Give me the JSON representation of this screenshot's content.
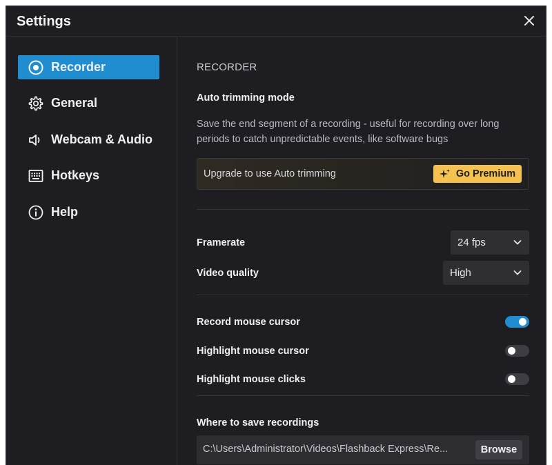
{
  "window": {
    "title": "Settings"
  },
  "sidebar": {
    "items": [
      {
        "label": "Recorder",
        "icon": "record-icon",
        "active": true
      },
      {
        "label": "General",
        "icon": "gear-icon",
        "active": false
      },
      {
        "label": "Webcam & Audio",
        "icon": "speaker-icon",
        "active": false
      },
      {
        "label": "Hotkeys",
        "icon": "keyboard-icon",
        "active": false
      },
      {
        "label": "Help",
        "icon": "info-icon",
        "active": false
      }
    ]
  },
  "recorder": {
    "section_title": "RECORDER",
    "auto_trim": {
      "heading": "Auto trimming mode",
      "description": "Save the end segment of a recording - useful for recording over long periods to catch unpredictable events, like software bugs",
      "upgrade_text": "Upgrade to use Auto trimming",
      "premium_label": "Go Premium"
    },
    "framerate": {
      "label": "Framerate",
      "value": "24 fps"
    },
    "video_quality": {
      "label": "Video quality",
      "value": "High"
    },
    "toggles": [
      {
        "label": "Record mouse cursor",
        "on": true
      },
      {
        "label": "Highlight mouse cursor",
        "on": false
      },
      {
        "label": "Highlight mouse clicks",
        "on": false
      }
    ],
    "save_location": {
      "label": "Where to save recordings",
      "path": "C:\\Users\\Administrator\\Videos\\Flashback Express\\Re...",
      "browse_label": "Browse"
    }
  },
  "colors": {
    "accent": "#1f8dcf",
    "premium": "#f5c150",
    "background": "#1e1e22"
  }
}
